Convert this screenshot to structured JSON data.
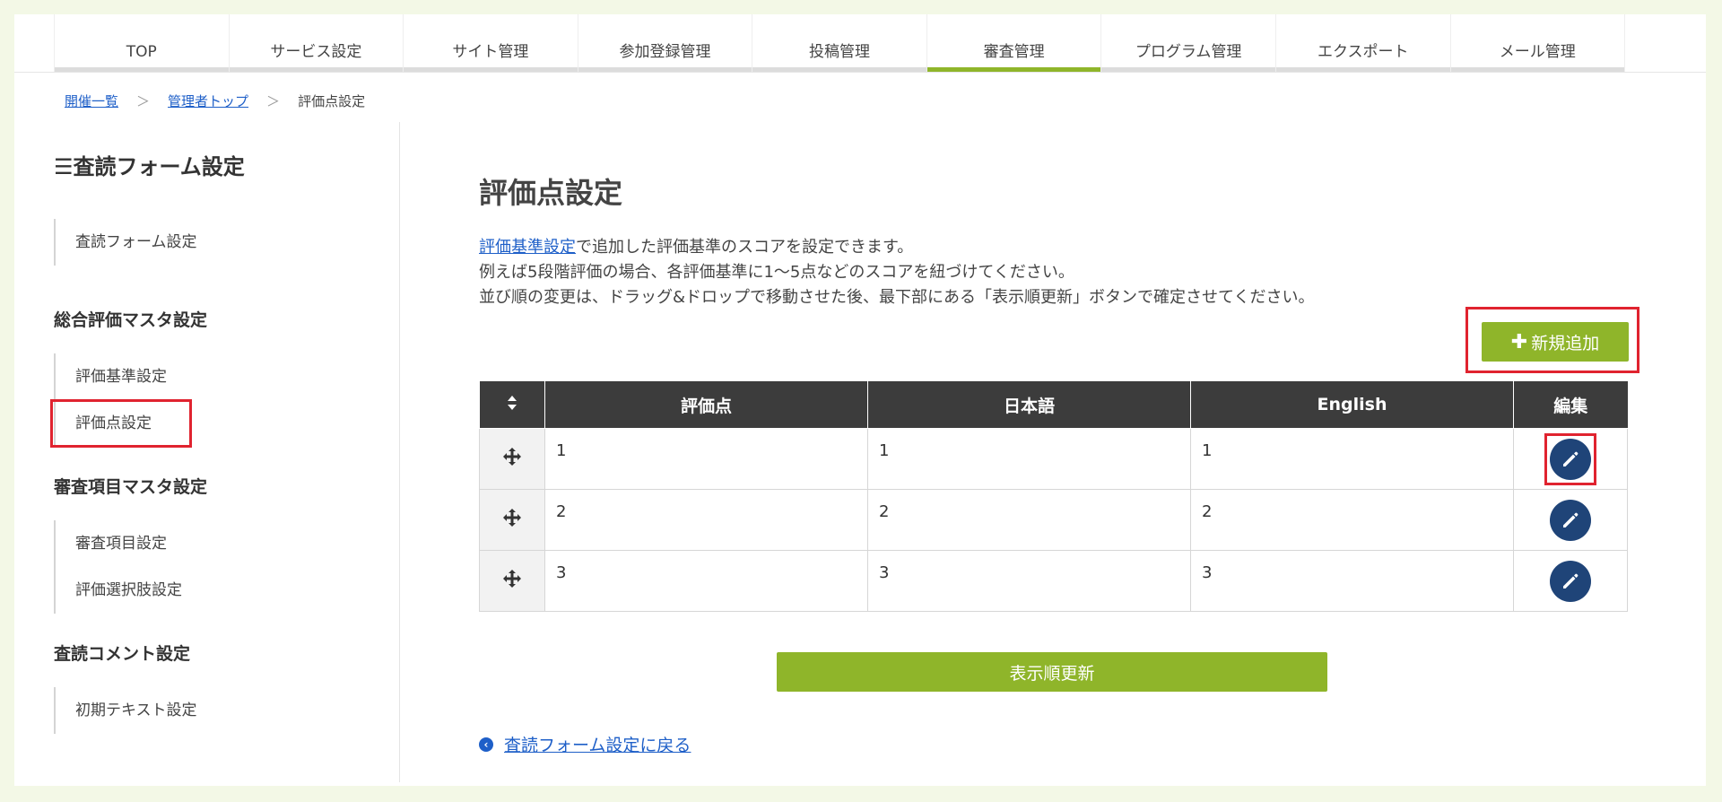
{
  "nav": {
    "tabs": [
      {
        "label": "TOP"
      },
      {
        "label": "サービス設定"
      },
      {
        "label": "サイト管理"
      },
      {
        "label": "参加登録管理"
      },
      {
        "label": "投稿管理"
      },
      {
        "label": "審査管理",
        "active": true
      },
      {
        "label": "プログラム管理"
      },
      {
        "label": "エクスポート"
      },
      {
        "label": "メール管理"
      }
    ]
  },
  "breadcrumb": {
    "items": [
      {
        "label": "開催一覧"
      },
      {
        "label": "管理者トップ"
      }
    ],
    "current": "評価点設定",
    "separator": "＞"
  },
  "sidebar": {
    "title": "査読フォーム設定",
    "title_icon": "bars-icon",
    "groups": [
      {
        "head": "",
        "items": [
          "査読フォーム設定"
        ]
      },
      {
        "head": "総合評価マスタ設定",
        "items": [
          "評価基準設定",
          "評価点設定"
        ]
      },
      {
        "head": "審査項目マスタ設定",
        "items": [
          "審査項目設定",
          "評価選択肢設定"
        ]
      },
      {
        "head": "査読コメント設定",
        "items": [
          "初期テキスト設定"
        ]
      }
    ],
    "highlight_item": "評価点設定"
  },
  "main": {
    "title": "評価点設定",
    "desc_link": "評価基準設定",
    "desc_line1_rest": "で追加した評価基準のスコアを設定できます。",
    "desc_line2": "例えば5段階評価の場合、各評価基準に1～5点などのスコアを紐づけてください。",
    "desc_line3": "並び順の変更は、ドラッグ&ドロップで移動させた後、最下部にある「表示順更新」ボタンで確定させてください。",
    "add_button": "新規追加",
    "table": {
      "headers": [
        "評価点",
        "日本語",
        "English",
        "編集"
      ],
      "rows": [
        [
          "1",
          "1",
          "1"
        ],
        [
          "2",
          "2",
          "2"
        ],
        [
          "3",
          "3",
          "3"
        ]
      ]
    },
    "update_button": "表示順更新",
    "back_link": "査読フォーム設定に戻る"
  },
  "colors": {
    "accent_green": "#8fb52a",
    "header_dark": "#3c3c3c",
    "edit_navy": "#1f4478",
    "link_blue": "#1e5fc8",
    "highlight_red": "#e0232f",
    "page_bg": "#f3f8e6"
  }
}
